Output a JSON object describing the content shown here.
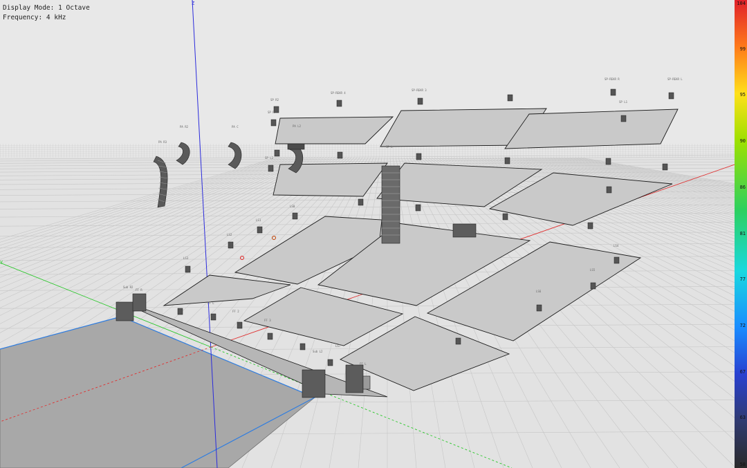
{
  "hud": {
    "display_mode": "Display Mode: 1 Octave",
    "frequency": "Frequency: 4 kHz"
  },
  "colorbar": {
    "labels": [
      "104",
      "99",
      "95",
      "90",
      "86",
      "81",
      "77",
      "72",
      "67",
      "63",
      "58"
    ]
  },
  "axes": {
    "z": "Z",
    "y": "Y"
  },
  "speakers": [
    "PA R2",
    "PA C",
    "PA L2",
    "PA R3",
    "SP R2",
    "SP R",
    "SP-REAR R",
    "SP-REAR L",
    "SP-REAR 3",
    "SP-REAR 4",
    "SP L2",
    "SP L1",
    "SP L",
    "Sub R2",
    "FF R",
    "FF L",
    "FF 2",
    "FF 3",
    "Sub L2",
    "FF L",
    "LS0",
    "LS1",
    "LS2",
    "LS3",
    "LS4",
    "LS5",
    "LS6",
    "LS7"
  ]
}
